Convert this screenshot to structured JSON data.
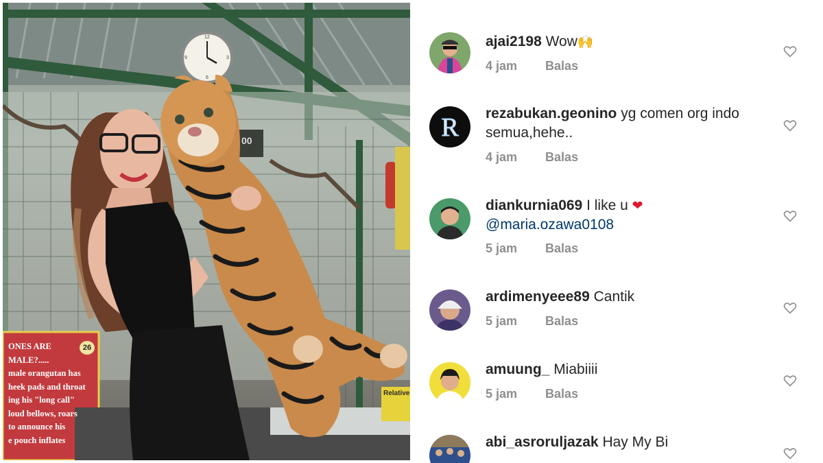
{
  "photo": {
    "sign_number": "26",
    "sign_lines": [
      "ONES ARE MALE?.....",
      "male orangutan has",
      "heek pads and throat",
      "ing his \"long call\"",
      "loud bellows, roars",
      "to announce his",
      "e pouch inflates"
    ],
    "board_number": "00",
    "side_sign_text": "Relatively"
  },
  "comments": [
    {
      "username": "ajai2198",
      "text": "Wow",
      "emoji": "🙌",
      "time": "4 jam",
      "reply_label": "Balas",
      "avatar": "boy-with-sunglasses-avatar"
    },
    {
      "username": "rezabukan.geonino",
      "text": "yg comen org indo semua,hehe..",
      "time": "4 jam",
      "reply_label": "Balas",
      "avatar": "letter-r-logo-avatar"
    },
    {
      "username": "diankurnia069",
      "text": "I like u",
      "emoji": "❤",
      "mention": "@maria.ozawa0108",
      "time": "5 jam",
      "reply_label": "Balas",
      "avatar": "smiling-person-avatar"
    },
    {
      "username": "ardimenyeee89",
      "text": "Cantik",
      "time": "5 jam",
      "reply_label": "Balas",
      "avatar": "person-with-cap-avatar"
    },
    {
      "username": "amuung_",
      "text": "Miabiiii",
      "time": "5 jam",
      "reply_label": "Balas",
      "avatar": "boy-yellow-background-avatar"
    },
    {
      "username": "abi_asroruljazak",
      "text": "Hay My Bi",
      "time": "",
      "reply_label": "",
      "avatar": "blue-crowd-avatar"
    }
  ],
  "colors": {
    "heart": "#e0172c",
    "mention": "#00376b",
    "meta": "#8e8e8e",
    "text": "#262626"
  }
}
